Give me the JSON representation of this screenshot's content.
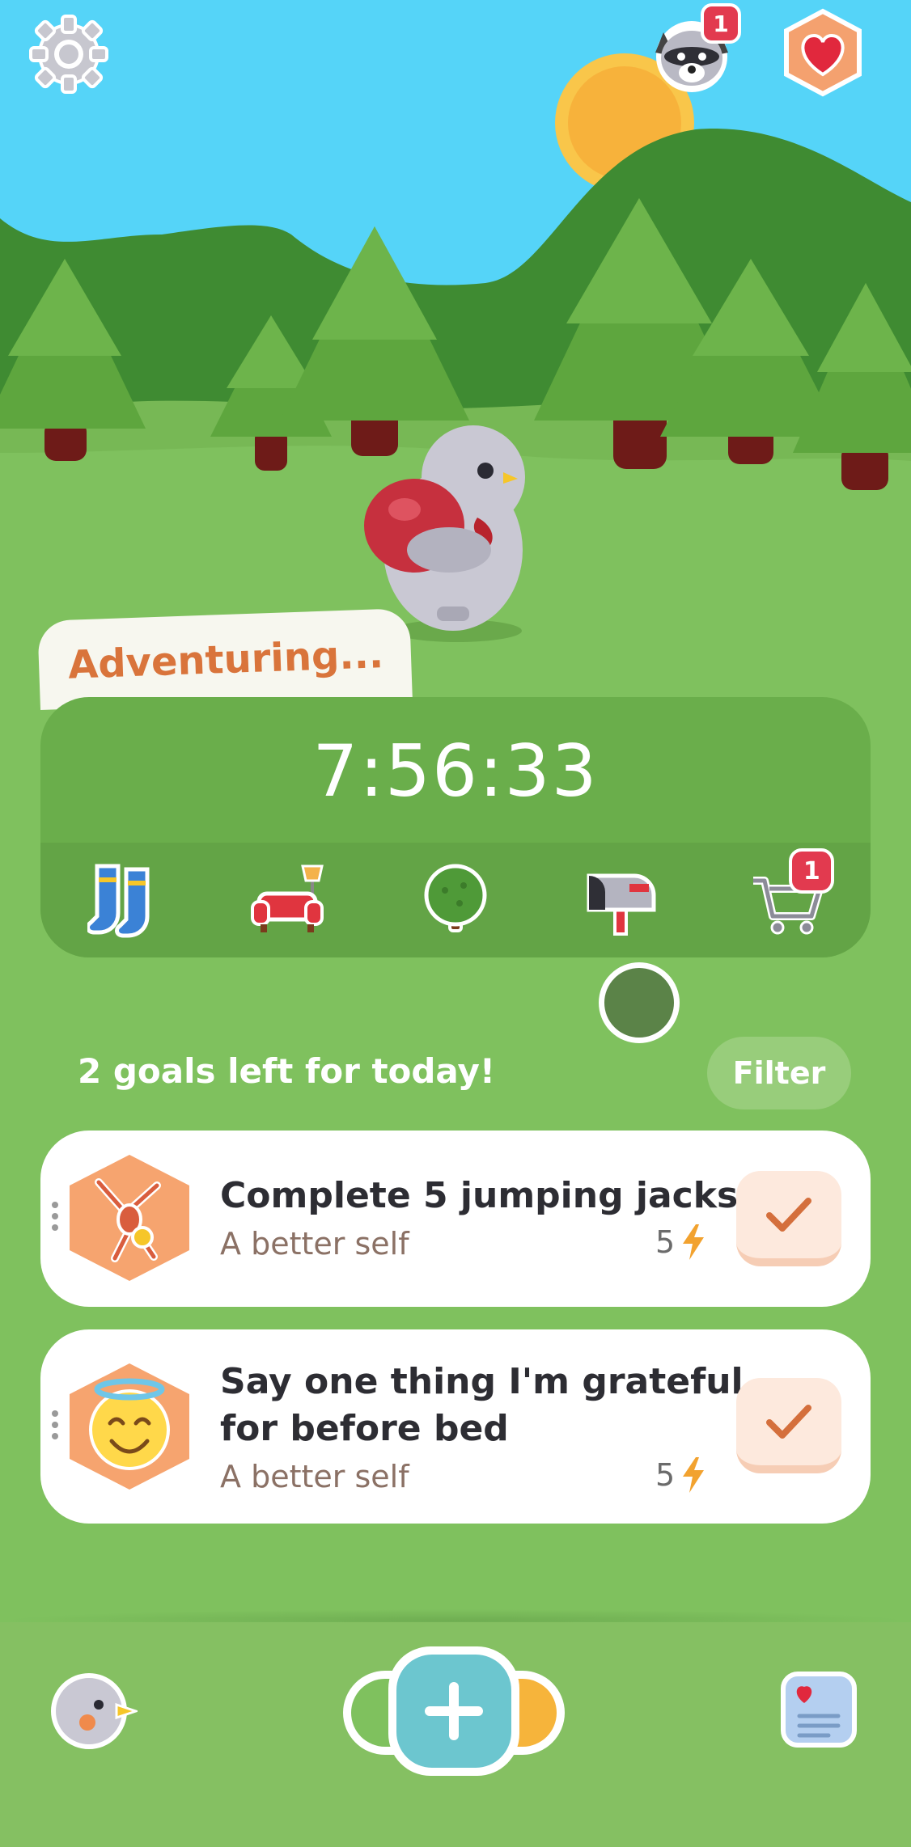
{
  "header": {
    "settings_icon": "gear-icon",
    "friend_icon": "raccoon-avatar-icon",
    "friend_badge": "1",
    "health_icon": "heart-icon"
  },
  "status": {
    "label": "Adventuring...",
    "timer": "7:56:33"
  },
  "items": [
    {
      "name": "socks-icon",
      "badge": ""
    },
    {
      "name": "sofa-icon",
      "badge": ""
    },
    {
      "name": "tree-icon",
      "badge": ""
    },
    {
      "name": "mailbox-icon",
      "badge": ""
    },
    {
      "name": "shopping-cart-icon",
      "badge": "1"
    }
  ],
  "goals": {
    "header": "2 goals left for today!",
    "filter_label": "Filter",
    "list": [
      {
        "title_line1": "Complete 5 jumping jacks",
        "title_line2": "",
        "category": "A better self",
        "points": "5",
        "icon": "jumping-jack-icon"
      },
      {
        "title_line1": "Say one thing I'm grateful",
        "title_line2": "for before bed",
        "category": "A better self",
        "points": "5",
        "icon": "smiling-angel-icon"
      }
    ]
  },
  "colors": {
    "sky": "#55d4f8",
    "grass": "#7fc15e",
    "accent_orange": "#d9743b",
    "check_bg": "#fde9dd",
    "add_button": "#6cc6cf"
  },
  "bottom_nav": {
    "profile_icon": "bird-avatar-icon",
    "add_icon": "plus-icon",
    "journal_icon": "journal-icon"
  }
}
